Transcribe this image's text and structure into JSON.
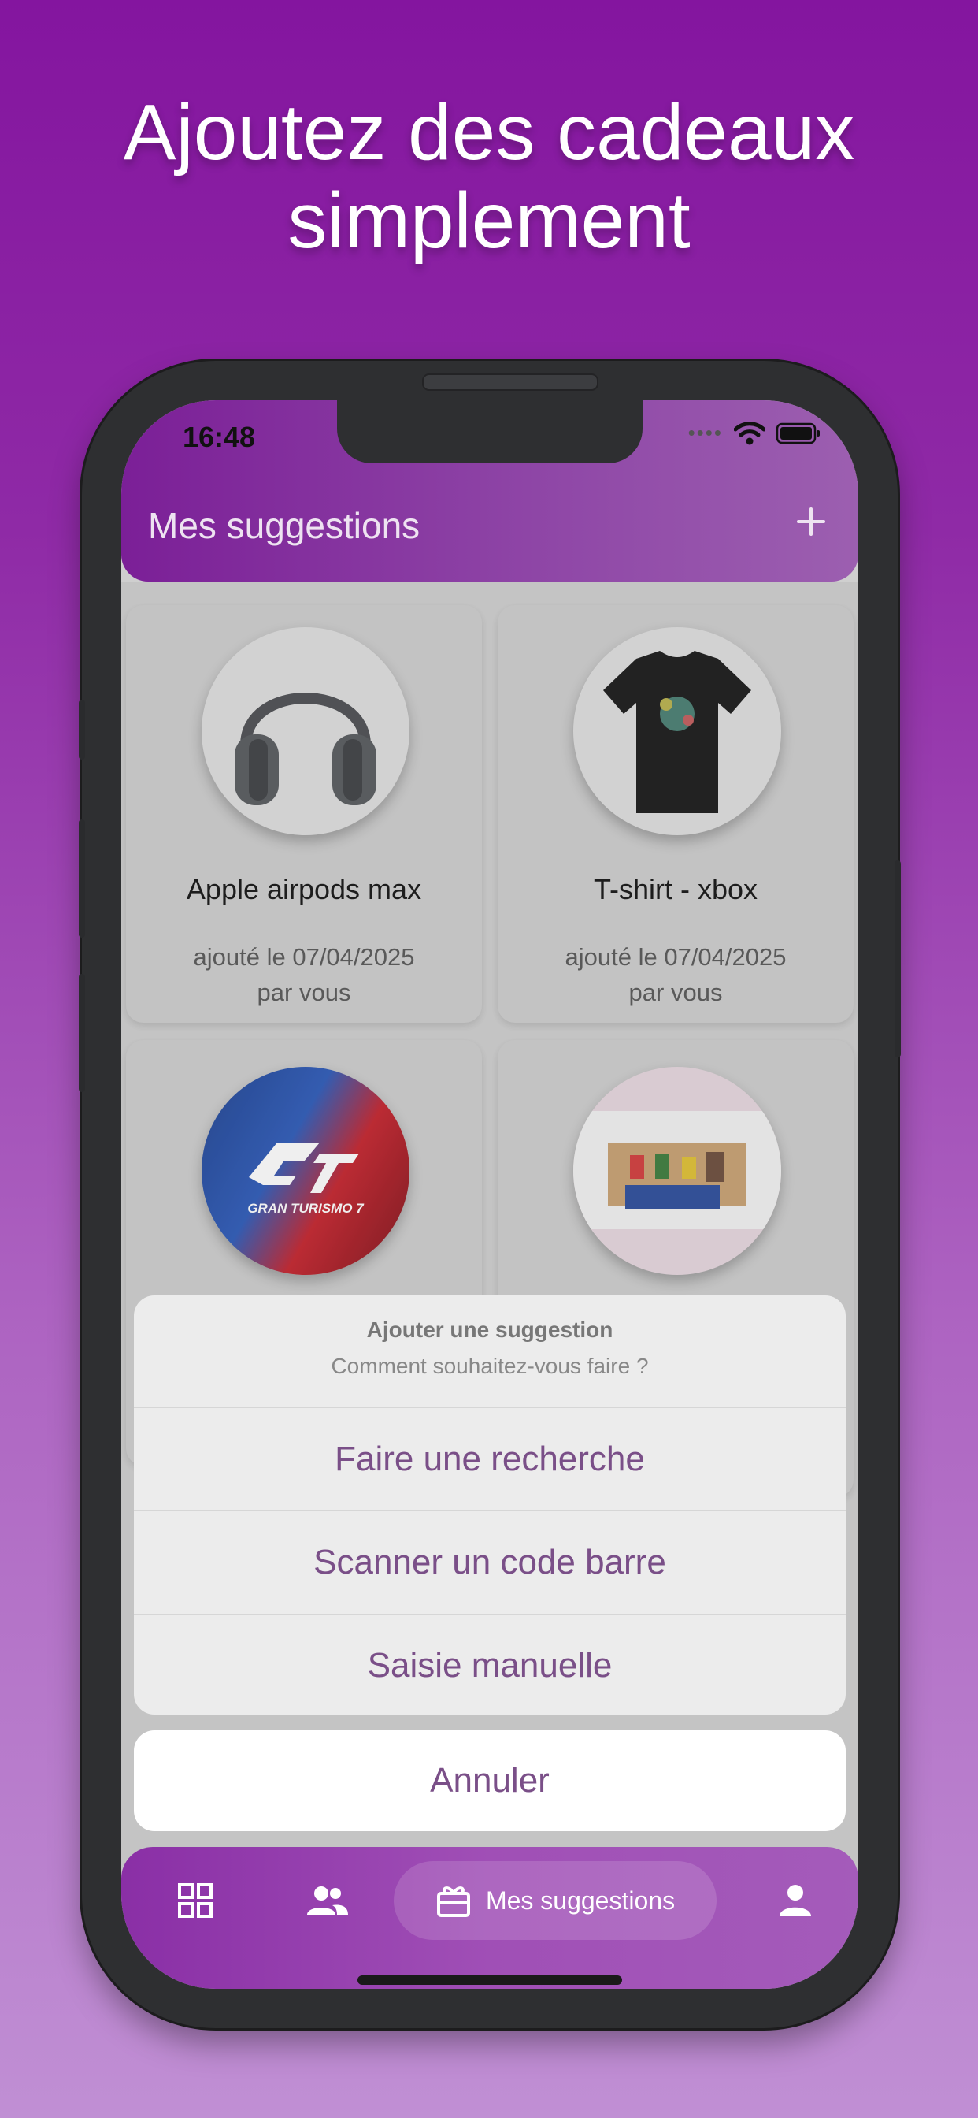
{
  "headline": {
    "line1": "Ajoutez des cadeaux",
    "line2": "simplement"
  },
  "status_bar": {
    "time": "16:48"
  },
  "header": {
    "title": "Mes suggestions"
  },
  "cards": [
    {
      "title": "Apple airpods max",
      "date_line": "ajouté le 07/04/2025",
      "by_line": "par vous",
      "image": "headphones"
    },
    {
      "title": "T-shirt - xbox",
      "date_line": "ajouté le 07/04/2025",
      "by_line": "par vous",
      "image": "tshirt"
    },
    {
      "title": "",
      "date_line": "",
      "by_line": "",
      "image": "gran-turismo-7-cover",
      "image_text": "GRAN TURISMO 7"
    },
    {
      "title": "",
      "date_line": "",
      "by_line": "",
      "image": "lego-set"
    }
  ],
  "action_sheet": {
    "title": "Ajouter une suggestion",
    "subtitle": "Comment souhaitez-vous faire ?",
    "options": [
      "Faire une recherche",
      "Scanner un code barre",
      "Saisie manuelle"
    ],
    "cancel": "Annuler"
  },
  "bottom_nav": {
    "items": [
      {
        "icon": "grid-icon"
      },
      {
        "icon": "people-icon"
      },
      {
        "icon": "gift-icon",
        "label": "Mes suggestions",
        "active": true
      },
      {
        "icon": "person-icon"
      }
    ]
  },
  "colors": {
    "accent": "#7a4f88",
    "header": "#7b1f97",
    "nav": "#a04fb6"
  }
}
